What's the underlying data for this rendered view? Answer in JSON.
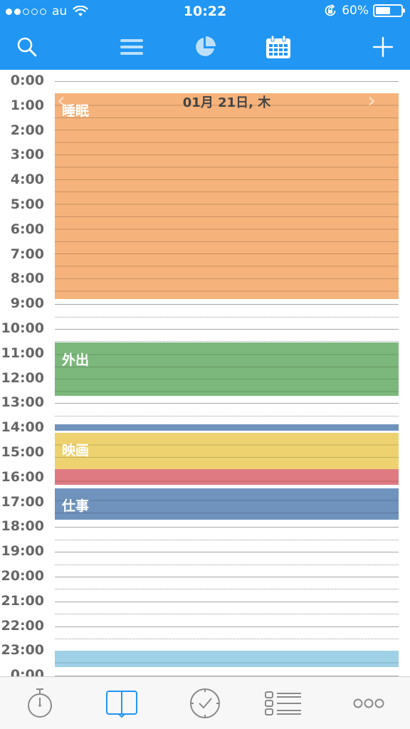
{
  "status_bar": {
    "carrier": "au",
    "signal_bars_filled": 2,
    "signal_bars_total": 5,
    "time": "10:22",
    "battery_percent_label": "60%",
    "battery_level": 0.6
  },
  "toolbar": {
    "buttons": [
      {
        "name": "search",
        "icon": "search-icon"
      },
      {
        "name": "list",
        "icon": "menu-list-icon"
      },
      {
        "name": "stats",
        "icon": "pie-chart-icon"
      },
      {
        "name": "calendar",
        "icon": "calendar-icon"
      },
      {
        "name": "add",
        "icon": "plus-icon"
      }
    ]
  },
  "timeline": {
    "date_header": "01月 21日, 木",
    "hours": [
      "0:00",
      "1:00",
      "2:00",
      "3:00",
      "4:00",
      "5:00",
      "6:00",
      "7:00",
      "8:00",
      "9:00",
      "10:00",
      "11:00",
      "12:00",
      "13:00",
      "14:00",
      "15:00",
      "16:00",
      "17:00",
      "18:00",
      "19:00",
      "20:00",
      "21:00",
      "22:00",
      "23:00",
      "0:00"
    ],
    "events": [
      {
        "label": "睡眠",
        "start": 0.5,
        "end": 8.8,
        "color": "#f5b27a"
      },
      {
        "label": "外出",
        "start": 10.55,
        "end": 12.7,
        "color": "#7cb87c"
      },
      {
        "label": "",
        "start": 13.85,
        "end": 14.1,
        "color": "#6f93bd"
      },
      {
        "label": "映画",
        "start": 14.2,
        "end": 15.65,
        "color": "#edd26f"
      },
      {
        "label": "",
        "start": 15.65,
        "end": 16.3,
        "color": "#e07a82"
      },
      {
        "label": "仕事",
        "start": 16.45,
        "end": 17.7,
        "color": "#6f93bd"
      },
      {
        "label": "",
        "start": 23.0,
        "end": 23.65,
        "color": "#9fd2e6"
      }
    ]
  },
  "tab_bar": {
    "tabs": [
      {
        "name": "timer",
        "icon": "stopwatch-icon",
        "active": false
      },
      {
        "name": "diary",
        "icon": "book-icon",
        "active": true
      },
      {
        "name": "check",
        "icon": "clock-check-icon",
        "active": false
      },
      {
        "name": "list",
        "icon": "checklist-icon",
        "active": false
      },
      {
        "name": "more",
        "icon": "more-icon",
        "active": false
      }
    ]
  },
  "colors": {
    "brand": "#2196f3",
    "active_tab": "#2196f3",
    "inactive_tab": "#8a8a8a",
    "hour_label": "#666666"
  }
}
